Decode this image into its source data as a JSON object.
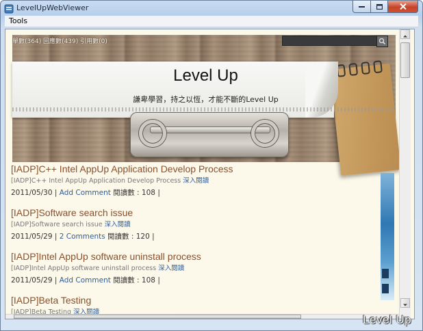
{
  "window": {
    "title": "LevelUpWebViewer"
  },
  "menu": {
    "items": [
      "Tools"
    ]
  },
  "blog": {
    "stats": "單數(364) 回應數(439) 引用數(0)",
    "search_placeholder": "",
    "title": "Level Up",
    "subtitle": "謙卑學習，持之以恆，才能不斷的Level Up"
  },
  "posts": [
    {
      "title": "[IADP]C++ Intel AppUp Application Develop Process",
      "excerpt": "[IADP]C++ Intel AppUp Application Develop Process",
      "more": "深入閱讀",
      "date": "2011/05/30",
      "comments": "Add Comment",
      "views": "閱讀數 : 108"
    },
    {
      "title": "[IADP]Software search issue",
      "excerpt": "[IADP]Software search issue",
      "more": "深入閱讀",
      "date": "2011/05/29",
      "comments": "2 Comments",
      "views": "閱讀數 : 120"
    },
    {
      "title": "[IADP]Intel AppUp software uninstall process",
      "excerpt": "[IADP]Intel AppUp software uninstall process",
      "more": "深入閱讀",
      "date": "2011/05/29",
      "comments": "Add Comment",
      "views": "閱讀數 : 108"
    },
    {
      "title": "[IADP]Beta Testing",
      "excerpt": "[IADP]Beta Testing",
      "more": "深入閱讀"
    }
  ],
  "watermark": "Level Up",
  "colors": {
    "post_title": "#8a4f2a",
    "link": "#2c5d9c",
    "page_bg": "#fdf9ea",
    "close_button": "#c6432a"
  },
  "icons": [
    "app-icon",
    "minimize-icon",
    "maximize-icon",
    "close-icon",
    "search-icon",
    "scroll-up-icon",
    "scroll-down-icon"
  ]
}
